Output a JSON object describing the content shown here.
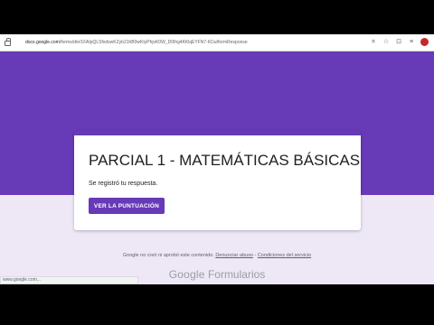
{
  "browser": {
    "url_domain": "docs.google.com",
    "url_path": "/forms/d/e/1FAIpQLSfxdxwKZyb21hB0wKtyPhjvK0W_D0Ihg4Kt0qEYFN7-6Cw/formResponse"
  },
  "form": {
    "title": "PARCIAL 1 - MATEMÁTICAS BÁSICAS",
    "confirmation": "Se registró tu respuesta.",
    "score_button": "VER LA PUNTUACIÓN"
  },
  "footer": {
    "text": "Google no creó ni aprobó este contenido.",
    "report_link": "Denunciar abuso",
    "separator": "-",
    "terms_link": "Condiciones del servicio"
  },
  "brand": {
    "google": "Google",
    "product": "Formularios"
  },
  "status_bar": {
    "text": "www.google.com..."
  },
  "colors": {
    "accent": "#673ab7",
    "background": "#ede7f6"
  }
}
